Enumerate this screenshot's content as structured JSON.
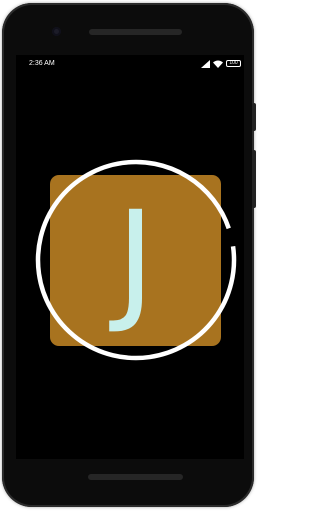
{
  "status_bar": {
    "time": "2:36 AM",
    "battery": "100"
  },
  "app": {
    "logo_letter": "J",
    "logo_color": "#a8731f",
    "letter_color": "#c8f0ec",
    "ring_color": "#ffffff",
    "screen_color": "#000000"
  },
  "icons": [
    "camera-icon",
    "signal-icon",
    "wifi-icon",
    "battery-icon"
  ]
}
